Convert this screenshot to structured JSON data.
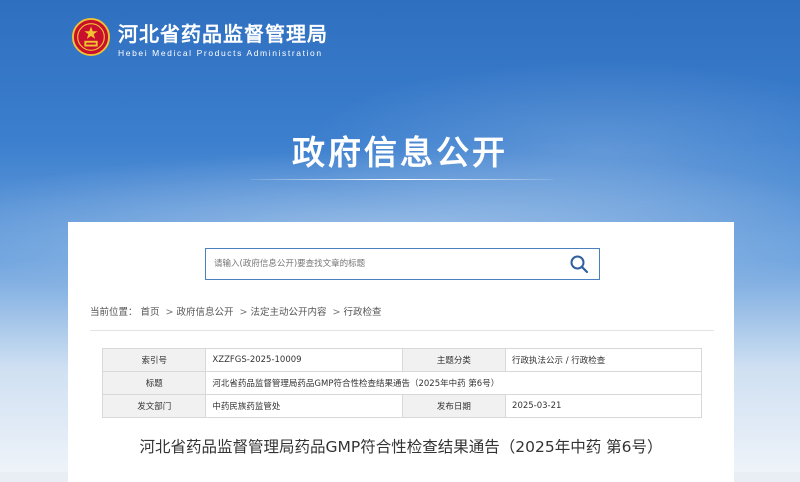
{
  "header": {
    "site_name": "河北省药品监督管理局",
    "site_name_en": "Hebei Medical Products Administration",
    "page_title": "政府信息公开"
  },
  "search": {
    "placeholder": "请输入(政府信息公开)要查找文章的标题",
    "button_icon": "search-icon"
  },
  "breadcrumb": {
    "prefix": "当前位置：",
    "items": [
      "首页",
      "政府信息公开",
      "法定主动公开内容",
      "行政检查"
    ],
    "separator": ">"
  },
  "meta_table": {
    "rows": [
      {
        "k1": "索引号",
        "v1": "XZZFGS-2025-10009",
        "k2": "主题分类",
        "v2": "行政执法公示 / 行政检查"
      },
      {
        "k1": "标题",
        "v1": "河北省药品监督管理局药品GMP符合性检查结果通告（2025年中药 第6号）"
      },
      {
        "k1": "发文部门",
        "v1": "中药民族药监管处",
        "k2": "发布日期",
        "v2": "2025-03-21"
      }
    ]
  },
  "document": {
    "title": "河北省药品监督管理局药品GMP符合性检查结果通告（2025年中药 第6号）"
  },
  "colors": {
    "brand_blue": "#2f6fc0",
    "search_border": "#4a7fc0"
  }
}
